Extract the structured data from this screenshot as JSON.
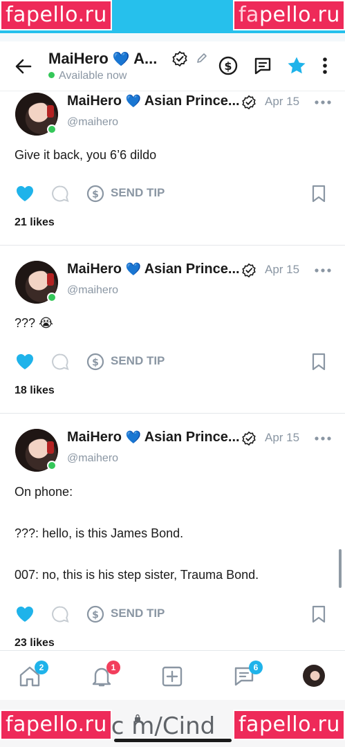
{
  "watermarks": {
    "tl_a": "fa",
    "tl_b": "pello.ru",
    "tr_a": "fa",
    "tr_b": "pello.ru",
    "bl": "fapello.ru",
    "br": "fapello.ru"
  },
  "header": {
    "title": "MaiHero",
    "title_suffix": "A...",
    "heart_emoji": "💙",
    "status": "Available now",
    "icons": [
      "back-arrow-icon",
      "verified-icon",
      "edit-icon",
      "dollar-circle-icon",
      "message-icon",
      "star-icon",
      "more-vertical-icon"
    ]
  },
  "posts": [
    {
      "name": "MaiHero",
      "name_suffix": "Asian Prince...",
      "date": "Apr 15",
      "handle": "@maihero",
      "text": "Give it back, you 6’6 dildo",
      "tip_label": "SEND TIP",
      "likes": "21 likes",
      "liked": true
    },
    {
      "name": "MaiHero",
      "name_suffix": "Asian Prince...",
      "date": "Apr 15",
      "handle": "@maihero",
      "text": "??? 😭",
      "tip_label": "SEND TIP",
      "likes": "18 likes",
      "liked": true
    },
    {
      "name": "MaiHero",
      "name_suffix": "Asian Prince...",
      "date": "Apr 15",
      "handle": "@maihero",
      "text": "On phone:\n\n???: hello, is this James Bond.\n\n007: no, this is his step sister, Trauma Bond.",
      "tip_label": "SEND TIP",
      "likes": "23 likes",
      "liked": true
    }
  ],
  "bottom_nav": {
    "home_badge": "2",
    "notifications_badge": "1",
    "messages_badge": "6"
  },
  "browser": {
    "url": ".c m/Cind"
  },
  "colors": {
    "accent": "#1fb3ea",
    "watermark": "#ee2a59",
    "online": "#34c759",
    "muted": "#8a96a3"
  }
}
